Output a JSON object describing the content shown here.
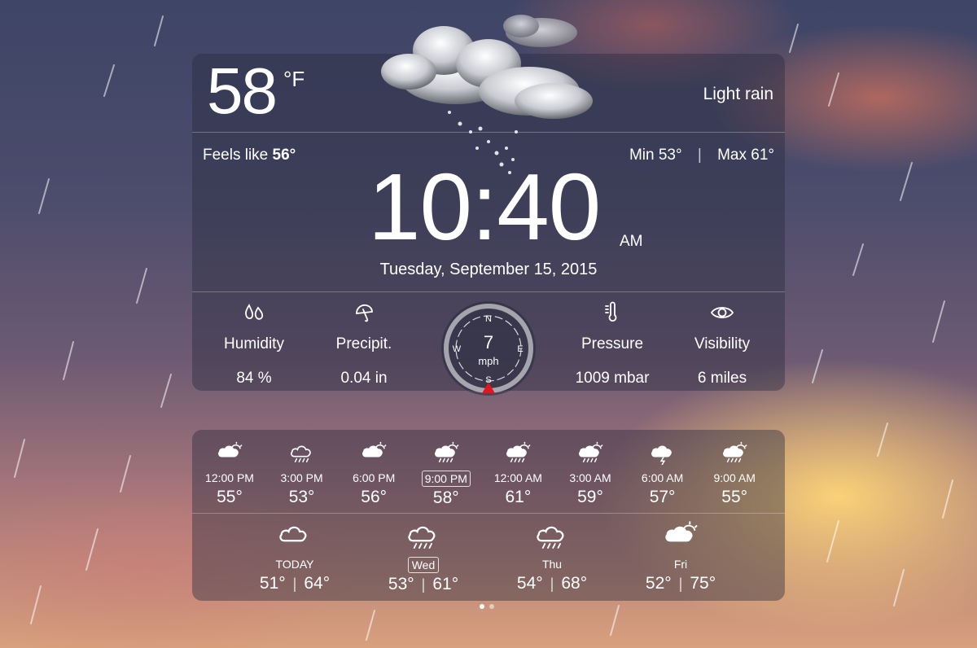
{
  "current": {
    "temperature": "58",
    "unit": "°F",
    "condition": "Light rain",
    "feels_like_label": "Feels like",
    "feels_like_value": "56°",
    "min_label": "Min",
    "min_value": "53°",
    "max_label": "Max",
    "max_value": "61°"
  },
  "clock": {
    "time": "10:40",
    "ampm": "AM",
    "date": "Tuesday, September 15, 2015"
  },
  "metrics": {
    "humidity": {
      "label": "Humidity",
      "value": "84 %",
      "icon": "drops-icon"
    },
    "precip": {
      "label": "Precipit.",
      "value": "0.04 in",
      "icon": "umbrella-icon"
    },
    "pressure": {
      "label": "Pressure",
      "value": "1009 mbar",
      "icon": "thermometer-icon"
    },
    "visibility": {
      "label": "Visibility",
      "value": "6 miles",
      "icon": "eye-icon"
    }
  },
  "wind": {
    "speed": "7",
    "unit": "mph",
    "compass": {
      "n": "N",
      "e": "E",
      "s": "S",
      "w": "W"
    },
    "direction": "S",
    "accent_color": "#e8141c"
  },
  "hourly": [
    {
      "time": "12:00 PM",
      "temp": "55°",
      "icon": "cloud-sun-icon",
      "selected": false
    },
    {
      "time": "3:00 PM",
      "temp": "53°",
      "icon": "cloud-rain-icon",
      "selected": false
    },
    {
      "time": "6:00 PM",
      "temp": "56°",
      "icon": "cloud-sun-icon",
      "selected": false
    },
    {
      "time": "9:00 PM",
      "temp": "58°",
      "icon": "cloud-sun-rain-icon",
      "selected": true
    },
    {
      "time": "12:00 AM",
      "temp": "61°",
      "icon": "cloud-sun-rain-icon",
      "selected": false
    },
    {
      "time": "3:00 AM",
      "temp": "59°",
      "icon": "cloud-sun-rain-icon",
      "selected": false
    },
    {
      "time": "6:00 AM",
      "temp": "57°",
      "icon": "cloud-storm-icon",
      "selected": false
    },
    {
      "time": "9:00 AM",
      "temp": "55°",
      "icon": "cloud-sun-rain-icon",
      "selected": false
    }
  ],
  "daily": [
    {
      "day": "TODAY",
      "low": "51°",
      "high": "64°",
      "icon": "cloud-icon",
      "selected": false
    },
    {
      "day": "Wed",
      "low": "53°",
      "high": "61°",
      "icon": "cloud-rain-icon",
      "selected": true
    },
    {
      "day": "Thu",
      "low": "54°",
      "high": "68°",
      "icon": "cloud-rain-icon",
      "selected": false
    },
    {
      "day": "Fri",
      "low": "52°",
      "high": "75°",
      "icon": "cloud-sun-icon",
      "selected": false
    }
  ],
  "pager": {
    "count": 2,
    "active": 0
  }
}
